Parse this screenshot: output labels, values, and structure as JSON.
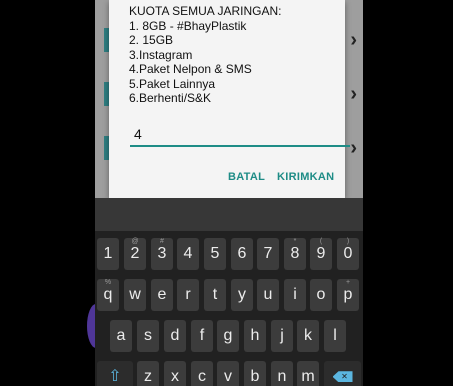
{
  "dialog": {
    "message_lines": [
      "KUOTA SEMUA JARINGAN:",
      "1. 8GB - #BhayPlastik",
      "2. 15GB",
      "3.Instagram",
      "4.Paket Nelpon & SMS",
      "5.Paket Lainnya",
      "6.Berhenti/S&K"
    ],
    "input_value": "4",
    "cancel_label": "BATAL",
    "send_label": "KIRIMKAN"
  },
  "background_list": {
    "chevron_icon": "chevron-right-icon",
    "accent": "#2f7f82"
  },
  "keyboard": {
    "row_numbers": [
      "1",
      "2",
      "3",
      "4",
      "5",
      "6",
      "7",
      "8",
      "9",
      "0"
    ],
    "row_numbers_hints": [
      "",
      "@",
      "#",
      "",
      "",
      "",
      "",
      "*",
      "(",
      ")"
    ],
    "row_top": [
      "q",
      "w",
      "e",
      "r",
      "t",
      "y",
      "u",
      "i",
      "o",
      "p"
    ],
    "row_top_hints": [
      "%",
      "",
      "",
      "",
      "",
      "",
      "",
      "",
      "",
      "+"
    ],
    "row_home": [
      "a",
      "s",
      "d",
      "f",
      "g",
      "h",
      "j",
      "k",
      "l"
    ],
    "row_bottom": [
      "z",
      "x",
      "c",
      "v",
      "b",
      "n",
      "m"
    ],
    "shift_icon": "shift-icon",
    "delete_icon": "backspace-icon",
    "accent": "#5bb6e0"
  }
}
